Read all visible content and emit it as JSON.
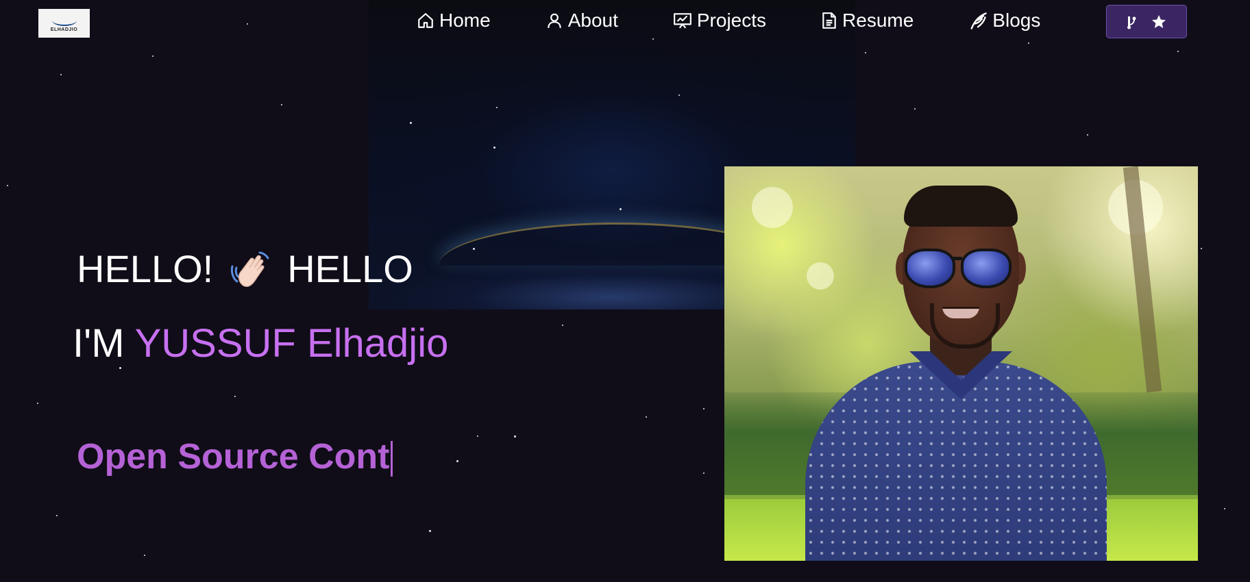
{
  "logo": {
    "text": "ELHADJIO"
  },
  "nav": {
    "items": [
      {
        "label": "Home",
        "icon": "home-icon"
      },
      {
        "label": "About",
        "icon": "user-icon"
      },
      {
        "label": "Projects",
        "icon": "presentation-icon"
      },
      {
        "label": "Resume",
        "icon": "document-icon"
      },
      {
        "label": "Blogs",
        "icon": "feather-icon"
      }
    ],
    "github_button": {
      "icons": [
        "git-fork-icon",
        "star-icon"
      ]
    }
  },
  "hero": {
    "hello_start": "HELLO!",
    "hello_end": "HELLO",
    "name_prefix": "I'M",
    "name_highlight": "YUSSUF Elhadjio",
    "typed_text": "Open Source Cont"
  },
  "colors": {
    "background": "#100d18",
    "accent": "#c770f0",
    "typed": "#b562d6",
    "button_bg": "#3b2663",
    "text": "#ffffff"
  },
  "portrait": {
    "alt": "portrait photo"
  }
}
